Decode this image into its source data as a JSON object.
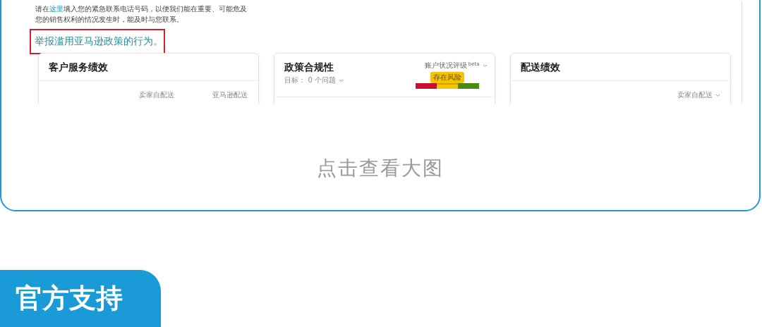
{
  "screenshot": {
    "notice": {
      "before": "请在",
      "link": "这里",
      "after": "填入您的紧急联系电话号码，以便我们能在重要、可能危及",
      "line2": "您的销售权利的情况发生时，能及时与您联系。"
    },
    "report_link": "举报滥用亚马逊政策的行为。",
    "cards": [
      {
        "kind": "service",
        "title": "客户服务绩效",
        "columns": [
          "卖家自配送",
          "亚马逊配送"
        ]
      },
      {
        "kind": "policy",
        "title": "政策合规性",
        "target": "目标： 0 个问题",
        "rating_label": "账户状况评级",
        "rating_tag": "beta",
        "status": "存在风险",
        "segments": [
          {
            "color": "#c8102e",
            "selected": false
          },
          {
            "color": "#f5c400",
            "selected": true
          },
          {
            "color": "#4a8a12",
            "selected": false
          }
        ]
      },
      {
        "kind": "shipping",
        "title": "配送绩效",
        "filter": "卖家自配送"
      }
    ]
  },
  "caption": "点击查看大图",
  "section_tab": "官方支持"
}
